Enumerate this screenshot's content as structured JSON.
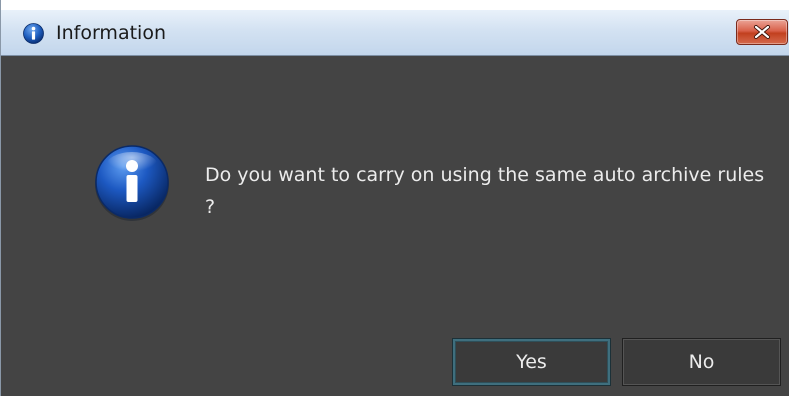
{
  "window": {
    "title": "Information",
    "title_icon": "info-icon",
    "close_icon": "close-icon"
  },
  "dialog": {
    "icon": "info-icon",
    "message": "Do you want to carry on using the same auto archive rules ?",
    "buttons": {
      "yes_label": "Yes",
      "no_label": "No"
    }
  },
  "colors": {
    "body_background": "#444444",
    "text": "#ececec",
    "info_blue": "#1e5bb8",
    "close_red": "#c94a2e"
  }
}
